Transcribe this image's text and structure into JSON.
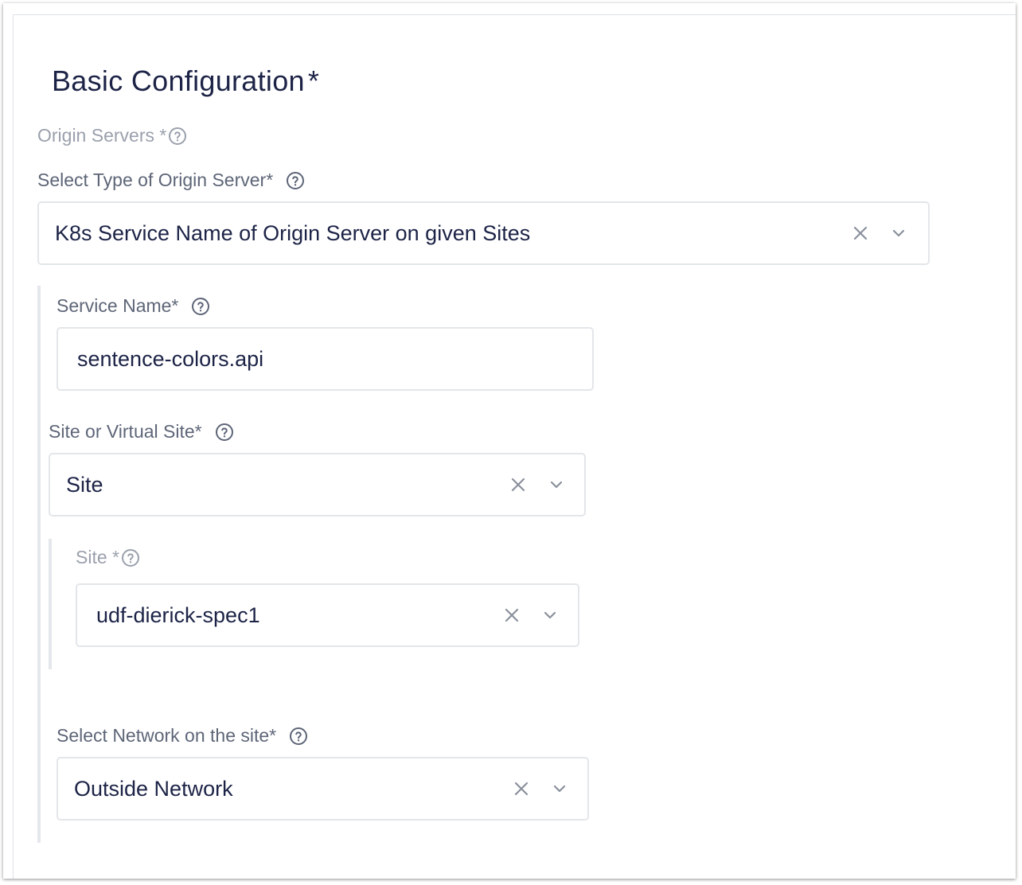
{
  "section": {
    "title": "Basic Configuration",
    "required_mark": "*"
  },
  "origin_servers": {
    "label": "Origin Servers *"
  },
  "origin_type": {
    "label": "Select Type of Origin Server*",
    "value": "K8s Service Name of Origin Server on given Sites"
  },
  "service_name": {
    "label": "Service Name*",
    "value": "sentence-colors.api"
  },
  "site_or_virtual": {
    "label": "Site or Virtual Site*",
    "value": "Site"
  },
  "site": {
    "label": "Site *",
    "value": "udf-dierick-spec1"
  },
  "network": {
    "label": "Select Network on the site*",
    "value": "Outside Network"
  },
  "icons": {
    "help": "question-circle-icon",
    "clear": "close-x-icon",
    "dropdown": "chevron-down-icon"
  },
  "colors": {
    "text_dark": "#1c2346",
    "label": "#5d6577",
    "label_muted": "#9aa0ac",
    "border": "#e3e6ea"
  }
}
